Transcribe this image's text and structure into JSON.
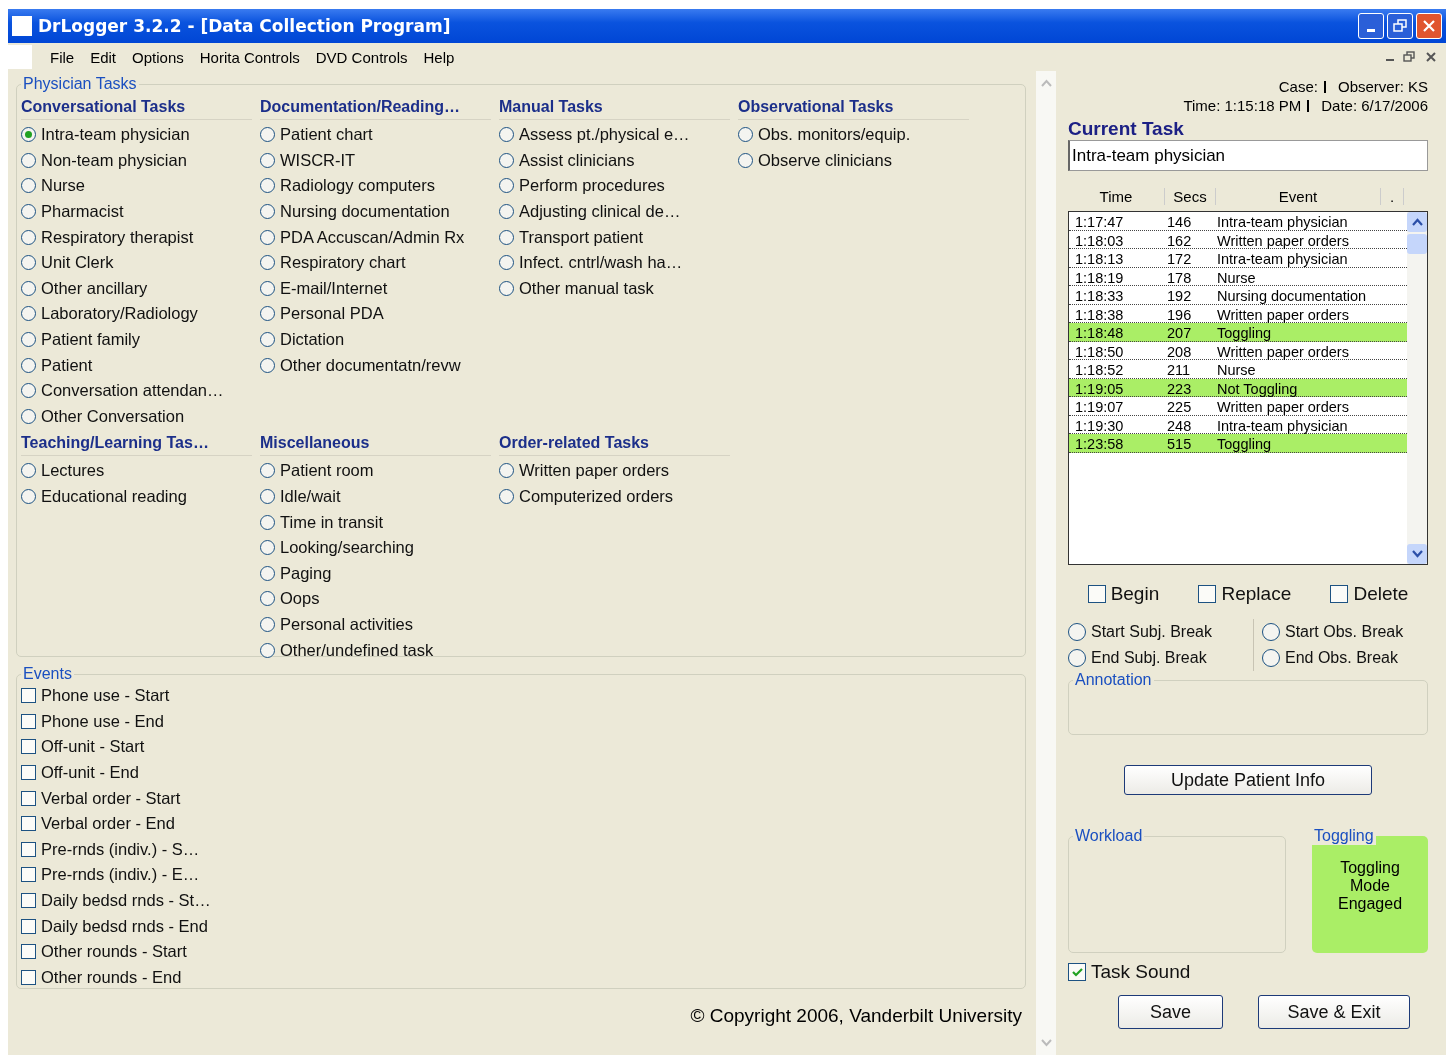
{
  "window": {
    "title": "DrLogger 3.2.2 - [Data Collection Program]"
  },
  "menu": [
    "File",
    "Edit",
    "Options",
    "Horita Controls",
    "DVD Controls",
    "Help"
  ],
  "physician_tasks": {
    "title": "Physician Tasks",
    "groups": [
      {
        "title": "Conversational Tasks",
        "tasks": [
          {
            "label": "Intra-team physician",
            "selected": true
          },
          {
            "label": "Non-team physician",
            "selected": false
          },
          {
            "label": "Nurse",
            "selected": false
          },
          {
            "label": "Pharmacist",
            "selected": false
          },
          {
            "label": "Respiratory therapist",
            "selected": false
          },
          {
            "label": "Unit Clerk",
            "selected": false
          },
          {
            "label": "Other ancillary",
            "selected": false
          },
          {
            "label": "Laboratory/Radiology",
            "selected": false
          },
          {
            "label": "Patient family",
            "selected": false
          },
          {
            "label": "Patient",
            "selected": false
          },
          {
            "label": "Conversation attendan…",
            "selected": false
          },
          {
            "label": "Other Conversation",
            "selected": false
          }
        ]
      },
      {
        "title": "Documentation/Reading…",
        "tasks": [
          {
            "label": "Patient chart",
            "selected": false
          },
          {
            "label": "WISCR-IT",
            "selected": false
          },
          {
            "label": "Radiology computers",
            "selected": false
          },
          {
            "label": "Nursing documentation",
            "selected": false
          },
          {
            "label": "PDA Accuscan/Admin Rx",
            "selected": false
          },
          {
            "label": "Respiratory chart",
            "selected": false
          },
          {
            "label": "E-mail/Internet",
            "selected": false
          },
          {
            "label": "Personal PDA",
            "selected": false
          },
          {
            "label": "Dictation",
            "selected": false
          },
          {
            "label": "Other documentatn/revw",
            "selected": false
          }
        ]
      },
      {
        "title": "Manual Tasks",
        "tasks": [
          {
            "label": "Assess pt./physical e…",
            "selected": false
          },
          {
            "label": "Assist clinicians",
            "selected": false
          },
          {
            "label": "Perform procedures",
            "selected": false
          },
          {
            "label": "Adjusting clinical de…",
            "selected": false
          },
          {
            "label": "Transport patient",
            "selected": false
          },
          {
            "label": "Infect. cntrl/wash ha…",
            "selected": false
          },
          {
            "label": "Other manual task",
            "selected": false
          }
        ]
      },
      {
        "title": "Observational Tasks",
        "tasks": [
          {
            "label": "Obs. monitors/equip.",
            "selected": false
          },
          {
            "label": "Observe clinicians",
            "selected": false
          }
        ]
      },
      {
        "title": "Teaching/Learning Tas…",
        "tasks": [
          {
            "label": "Lectures",
            "selected": false
          },
          {
            "label": "Educational reading",
            "selected": false
          }
        ]
      },
      {
        "title": "Miscellaneous",
        "tasks": [
          {
            "label": "Patient room",
            "selected": false
          },
          {
            "label": "Idle/wait",
            "selected": false
          },
          {
            "label": "Time in transit",
            "selected": false
          },
          {
            "label": "Looking/searching",
            "selected": false
          },
          {
            "label": "Paging",
            "selected": false
          },
          {
            "label": "Oops",
            "selected": false
          },
          {
            "label": "Personal activities",
            "selected": false
          },
          {
            "label": "Other/undefined task",
            "selected": false
          }
        ]
      },
      {
        "title": "Order-related Tasks",
        "tasks": [
          {
            "label": "Written paper orders",
            "selected": false
          },
          {
            "label": "Computerized orders",
            "selected": false
          }
        ]
      }
    ]
  },
  "events": {
    "title": "Events",
    "items": [
      {
        "label": "Phone use - Start",
        "checked": false
      },
      {
        "label": "Phone use - End",
        "checked": false
      },
      {
        "label": "Off-unit - Start",
        "checked": false
      },
      {
        "label": "Off-unit - End",
        "checked": false
      },
      {
        "label": "Verbal order - Start",
        "checked": false
      },
      {
        "label": "Verbal order - End",
        "checked": false
      },
      {
        "label": "Pre-rnds (indiv.) - S…",
        "checked": false
      },
      {
        "label": "Pre-rnds (indiv.) - E…",
        "checked": false
      },
      {
        "label": "Daily bedsd rnds - St…",
        "checked": false
      },
      {
        "label": "Daily bedsd rnds - End",
        "checked": false
      },
      {
        "label": "Other rounds - Start",
        "checked": false
      },
      {
        "label": "Other rounds - End",
        "checked": false
      }
    ]
  },
  "copyright": "© Copyright 2006, Vanderbilt University",
  "session": {
    "case": "Case:",
    "observer": "Observer: KS",
    "time": "Time: 1:15:18 PM",
    "date": "Date: 6/17/2006"
  },
  "current_task": {
    "label": "Current Task",
    "value": "Intra-team physician"
  },
  "log": {
    "columns": [
      "Time",
      "Secs",
      "Event",
      "."
    ],
    "rows": [
      {
        "time": "1:17:47",
        "secs": "146",
        "event": "Intra-team physician",
        "highlighted": false
      },
      {
        "time": "1:18:03",
        "secs": "162",
        "event": "Written paper orders",
        "highlighted": false
      },
      {
        "time": "1:18:13",
        "secs": "172",
        "event": "Intra-team physician",
        "highlighted": false
      },
      {
        "time": "1:18:19",
        "secs": "178",
        "event": "Nurse",
        "highlighted": false
      },
      {
        "time": "1:18:33",
        "secs": "192",
        "event": "Nursing documentation",
        "highlighted": false
      },
      {
        "time": "1:18:38",
        "secs": "196",
        "event": "Written paper orders",
        "highlighted": false
      },
      {
        "time": "1:18:48",
        "secs": "207",
        "event": "Toggling",
        "highlighted": true
      },
      {
        "time": "1:18:50",
        "secs": "208",
        "event": "Written paper orders",
        "highlighted": false
      },
      {
        "time": "1:18:52",
        "secs": "211",
        "event": "Nurse",
        "highlighted": false
      },
      {
        "time": "1:19:05",
        "secs": "223",
        "event": "Not Toggling",
        "highlighted": true
      },
      {
        "time": "1:19:07",
        "secs": "225",
        "event": "Written paper orders",
        "highlighted": false
      },
      {
        "time": "1:19:30",
        "secs": "248",
        "event": "Intra-team physician",
        "highlighted": false
      },
      {
        "time": "1:23:58",
        "secs": "515",
        "event": "Toggling",
        "highlighted": true
      }
    ]
  },
  "edit_options": [
    {
      "label": "Begin",
      "checked": false
    },
    {
      "label": "Replace",
      "checked": false
    },
    {
      "label": "Delete",
      "checked": false
    }
  ],
  "breaks": [
    {
      "label": "Start Subj. Break",
      "selected": false
    },
    {
      "label": "Start Obs. Break",
      "selected": false
    },
    {
      "label": "End Subj. Break",
      "selected": false
    },
    {
      "label": "End Obs. Break",
      "selected": false
    }
  ],
  "annotation": {
    "title": "Annotation"
  },
  "update_button": "Update Patient Info",
  "workload": {
    "title": "Workload"
  },
  "toggling": {
    "title": "Toggling",
    "text": "Toggling Mode Engaged",
    "engaged": true
  },
  "task_sound": {
    "label": "Task Sound",
    "checked": true
  },
  "buttons": [
    "Save",
    "Save & Exit"
  ]
}
